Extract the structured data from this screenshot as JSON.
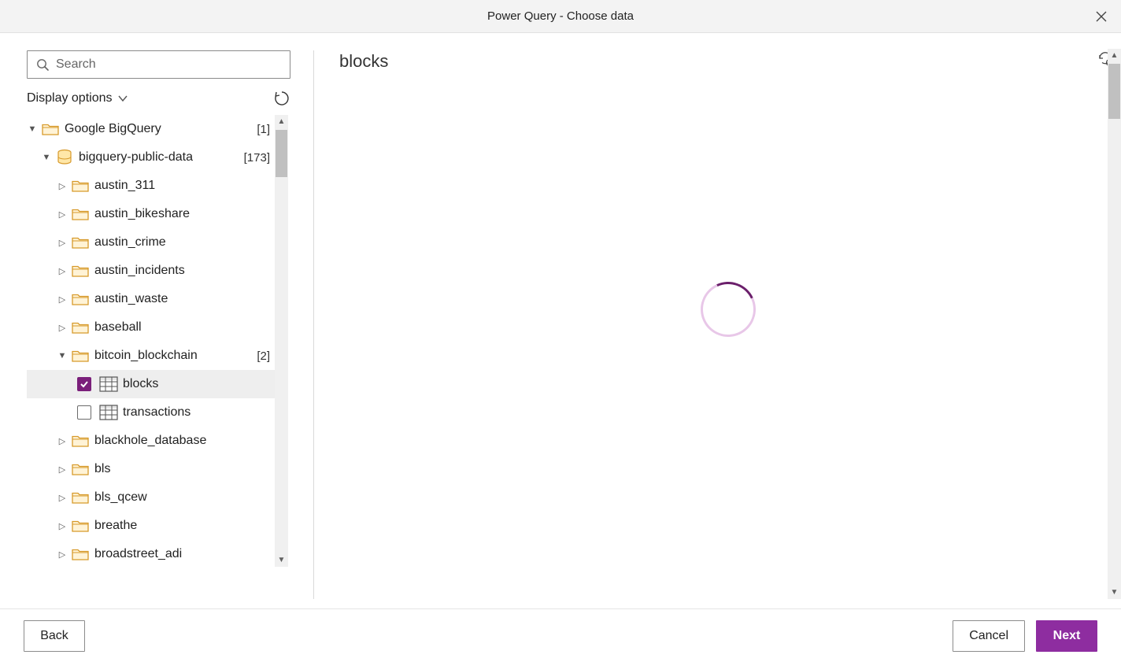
{
  "window": {
    "title": "Power Query - Choose data"
  },
  "search": {
    "placeholder": "Search"
  },
  "options": {
    "display_options_label": "Display options"
  },
  "tree": {
    "root": {
      "label": "Google BigQuery",
      "count": "[1]"
    },
    "project": {
      "label": "bigquery-public-data",
      "count": "[173]"
    },
    "datasets_before": [
      {
        "label": "austin_311"
      },
      {
        "label": "austin_bikeshare"
      },
      {
        "label": "austin_crime"
      },
      {
        "label": "austin_incidents"
      },
      {
        "label": "austin_waste"
      },
      {
        "label": "baseball"
      }
    ],
    "expanded_dataset": {
      "label": "bitcoin_blockchain",
      "count": "[2]"
    },
    "tables": [
      {
        "label": "blocks",
        "checked": true
      },
      {
        "label": "transactions",
        "checked": false
      }
    ],
    "datasets_after": [
      {
        "label": "blackhole_database"
      },
      {
        "label": "bls"
      },
      {
        "label": "bls_qcew"
      },
      {
        "label": "breathe"
      },
      {
        "label": "broadstreet_adi"
      }
    ]
  },
  "preview": {
    "title": "blocks"
  },
  "footer": {
    "back": "Back",
    "cancel": "Cancel",
    "next": "Next"
  }
}
